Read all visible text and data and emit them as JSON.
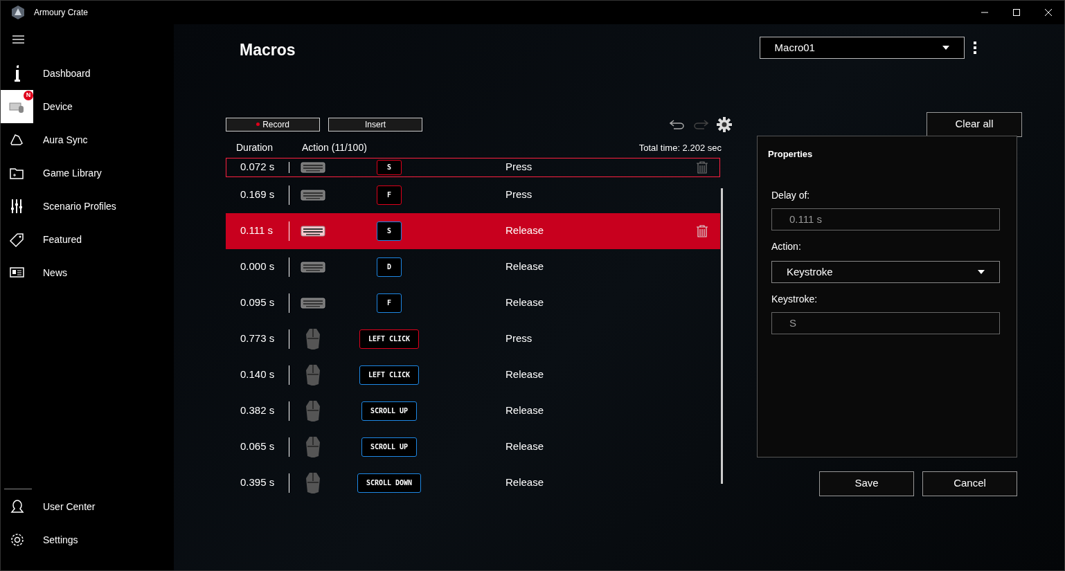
{
  "window": {
    "title": "Armoury Crate"
  },
  "sidebar": {
    "items": [
      {
        "kind": "dashboard",
        "label": "Dashboard",
        "selected": false
      },
      {
        "kind": "device",
        "label": "Device",
        "selected": true,
        "badge": "N"
      },
      {
        "kind": "aura",
        "label": "Aura Sync",
        "selected": false
      },
      {
        "kind": "games",
        "label": "Game Library",
        "selected": false
      },
      {
        "kind": "scenario",
        "label": "Scenario Profiles",
        "selected": false
      },
      {
        "kind": "featured",
        "label": "Featured",
        "selected": false
      },
      {
        "kind": "news",
        "label": "News",
        "selected": false
      }
    ],
    "bottom_items": [
      {
        "kind": "user",
        "label": "User Center",
        "selected": false
      },
      {
        "kind": "settings",
        "label": "Settings",
        "selected": false
      }
    ]
  },
  "page": {
    "title": "Macros",
    "macro_select": "Macro01"
  },
  "toolbar": {
    "record": "Record",
    "insert": "Insert",
    "redo_disabled": true,
    "clear_all": "Clear all"
  },
  "table": {
    "columns": [
      "Duration",
      "Action (11/100)"
    ],
    "total": "Total time: 2.202 sec",
    "rows": [
      {
        "duration": "0.072 s",
        "kind": "keyboard",
        "key": "S",
        "action": "Press",
        "color": "#e0001b",
        "selected": false,
        "focused": true,
        "cut": true
      },
      {
        "duration": "0.169 s",
        "kind": "keyboard",
        "key": "F",
        "action": "Press",
        "color": "#e0001b",
        "selected": false,
        "focused": false
      },
      {
        "duration": "0.111 s",
        "kind": "keyboard",
        "key": "S",
        "action": "Release",
        "color": "#1e88e5",
        "selected": true,
        "focused": false
      },
      {
        "duration": "0.000 s",
        "kind": "keyboard",
        "key": "D",
        "action": "Release",
        "color": "#1e88e5",
        "selected": false,
        "focused": false
      },
      {
        "duration": "0.095 s",
        "kind": "keyboard",
        "key": "F",
        "action": "Release",
        "color": "#1e88e5",
        "selected": false,
        "focused": false
      },
      {
        "duration": "0.773 s",
        "kind": "mouse",
        "key": "LEFT CLICK",
        "action": "Press",
        "color": "#e0001b",
        "selected": false,
        "focused": false
      },
      {
        "duration": "0.140 s",
        "kind": "mouse",
        "key": "LEFT CLICK",
        "action": "Release",
        "color": "#1e88e5",
        "selected": false,
        "focused": false
      },
      {
        "duration": "0.382 s",
        "kind": "mouse",
        "key": "SCROLL UP",
        "action": "Release",
        "color": "#1e88e5",
        "selected": false,
        "focused": false
      },
      {
        "duration": "0.065 s",
        "kind": "mouse",
        "key": "SCROLL UP",
        "action": "Release",
        "color": "#1e88e5",
        "selected": false,
        "focused": false
      },
      {
        "duration": "0.395 s",
        "kind": "mouse",
        "key": "SCROLL DOWN",
        "action": "Release",
        "color": "#1e88e5",
        "selected": false,
        "focused": false
      }
    ]
  },
  "properties": {
    "title": "Properties",
    "delay_label": "Delay of:",
    "delay_value": "0.111 s",
    "action_label": "Action:",
    "action_value": "Keystroke",
    "keystroke_label": "Keystroke:",
    "keystroke_value": "S"
  },
  "buttons": [
    "Save",
    "Cancel"
  ]
}
